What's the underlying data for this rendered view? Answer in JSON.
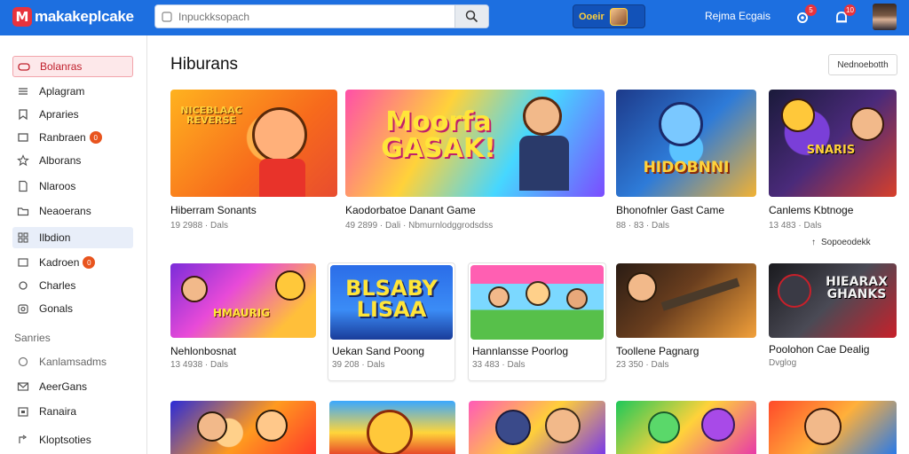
{
  "header": {
    "logo_text": "makakeplcake",
    "search_placeholder": "Inpuckksopach",
    "coins_label": "Ooeir",
    "links": [
      "Rejma",
      "Ecgais"
    ],
    "notif_badge": "5",
    "alerts_badge": "10"
  },
  "sidebar": {
    "items": [
      {
        "label": "Bolanras",
        "icon": "gamepad-icon"
      },
      {
        "label": "Aplagram",
        "icon": "menu-icon"
      },
      {
        "label": "Apraries",
        "icon": "bookmark-icon"
      },
      {
        "label": "Ranbraen",
        "icon": "download-icon",
        "badge": "0"
      },
      {
        "label": "Alborans",
        "icon": "star-icon"
      },
      {
        "label": "Nlaroos",
        "icon": "document-icon"
      },
      {
        "label": "Neaoerans",
        "icon": "folder-icon"
      },
      {
        "label": "Ilbdion",
        "icon": "grid-icon"
      },
      {
        "label": "Kadroen",
        "icon": "chat-icon",
        "badge": "0"
      },
      {
        "label": "Charles",
        "icon": "settings-icon"
      },
      {
        "label": "Gonals",
        "icon": "camera-icon"
      }
    ],
    "section_title": "Sanries",
    "section_items": [
      {
        "label": "Kanlamsadms",
        "icon": "link-icon"
      },
      {
        "label": "AeerGans",
        "icon": "mail-icon"
      },
      {
        "label": "Ranaira",
        "icon": "calendar-icon"
      },
      {
        "label": "Kloptsoties",
        "icon": "share-icon"
      }
    ]
  },
  "main": {
    "title": "Hiburans",
    "sort_label": "Nednoebotth",
    "upgrade_label": "Sopoeodekk",
    "cards": [
      {
        "title": "Hiberram Sonants",
        "meta": "19 2988 · Dals",
        "art": "NICEBLAAC REVERSE"
      },
      {
        "title": "Kaodorbatoe Danant Game",
        "meta": "49 2899 · Dali · Nbmurnlodggrodsdss",
        "art": "Moorfa GASAK!"
      },
      {
        "title": "Bhonofnler Gast Came",
        "meta": "88 · 83 · Dals",
        "art": "HIDOBNNI"
      },
      {
        "title": "Canlems Kbtnoge",
        "meta": "13 483 · Dals",
        "art": "SNARIS"
      },
      {
        "title": "Nehlonbosnat",
        "meta": "13 4938 · Dals",
        "art": "HMAURIG"
      },
      {
        "title": "Uekan Sand Poong",
        "meta": "39 208 · Dals",
        "art": "BLSABY LISAA"
      },
      {
        "title": "Hannlansse Poorlog",
        "meta": "33 483 · Dals",
        "art": ""
      },
      {
        "title": "Toollene Pagnarg",
        "meta": "23 350 · Dals",
        "art": ""
      },
      {
        "title": "Poolohon Cae Dealig",
        "meta": "Dvglog",
        "art": "HIEARAX GHANKS"
      },
      {
        "title": "",
        "meta": "",
        "art": ""
      },
      {
        "title": "",
        "meta": "",
        "art": ""
      },
      {
        "title": "",
        "meta": "",
        "art": ""
      },
      {
        "title": "",
        "meta": "",
        "art": ""
      },
      {
        "title": "",
        "meta": "",
        "art": ""
      }
    ]
  },
  "colors": {
    "header_bg": "#1d6fe0",
    "accent_red": "#e8333d",
    "active_bg": "#fde8ea"
  }
}
